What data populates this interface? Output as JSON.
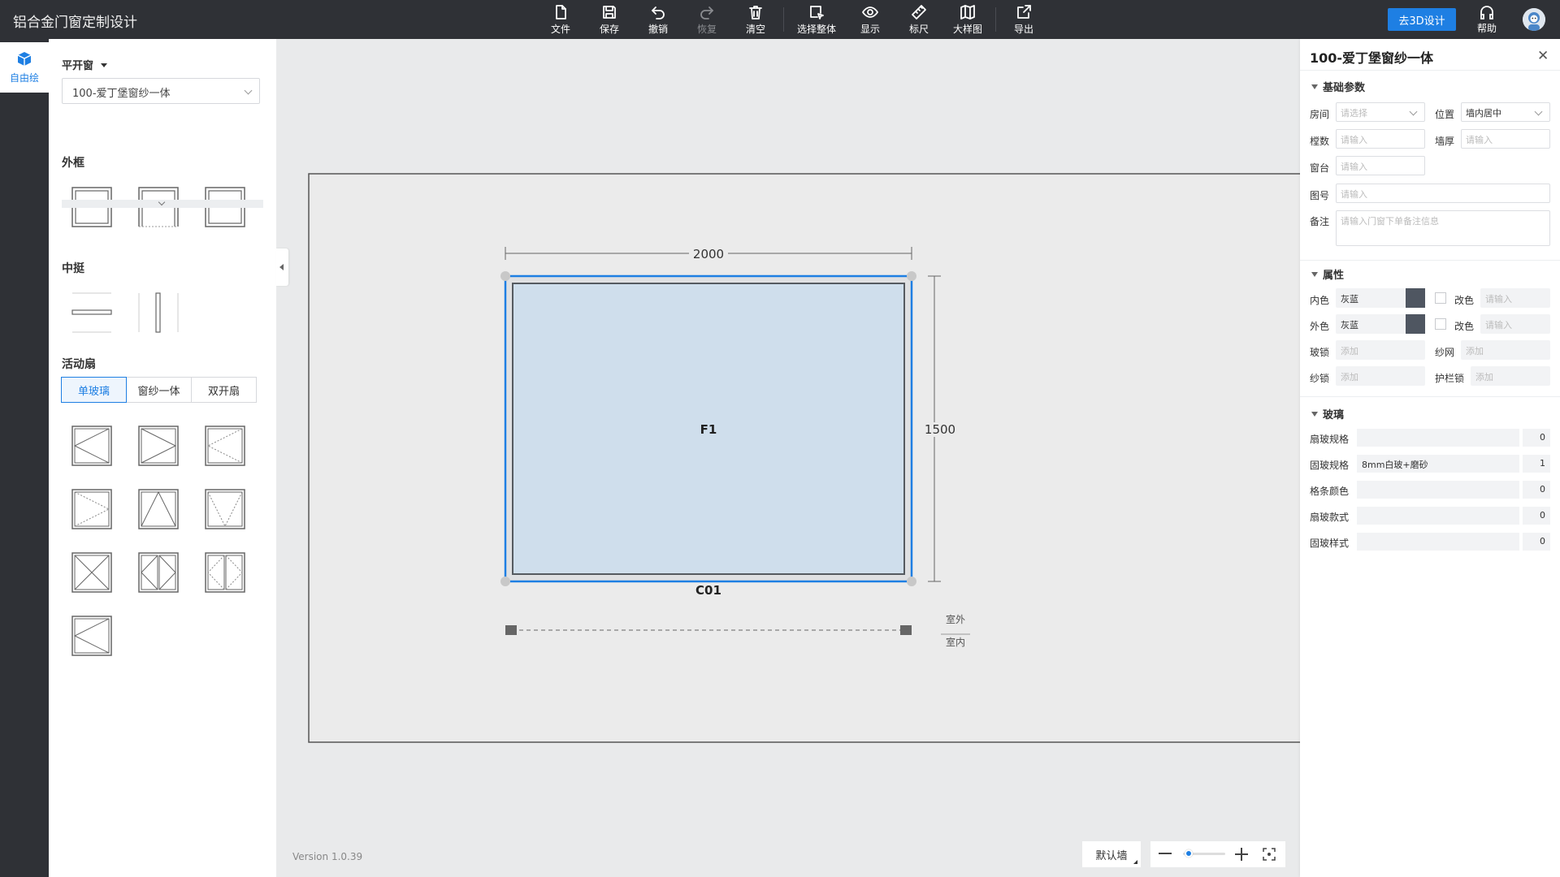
{
  "app": {
    "title": "铝合金门窗定制设计"
  },
  "toolbar": [
    {
      "label": "文件",
      "icon": "file-icon"
    },
    {
      "label": "保存",
      "icon": "save-icon"
    },
    {
      "label": "撤销",
      "icon": "undo-icon"
    },
    {
      "label": "恢复",
      "icon": "redo-icon",
      "disabled": true
    },
    {
      "label": "清空",
      "icon": "trash-icon"
    },
    {
      "label": "选择整体",
      "icon": "select-all-icon"
    },
    {
      "label": "显示",
      "icon": "eye-icon"
    },
    {
      "label": "标尺",
      "icon": "ruler-icon"
    },
    {
      "label": "大样图",
      "icon": "map-icon"
    },
    {
      "label": "导出",
      "icon": "export-icon"
    }
  ],
  "header": {
    "btn_3d": "去3D设计",
    "help": "帮助"
  },
  "rail": {
    "free_draw": "自由绘"
  },
  "left_panel": {
    "category": "平开窗",
    "series_select": "100-爱丁堡窗纱一体",
    "sections": {
      "outer_frame": "外框",
      "mullion": "中挺",
      "sash": "活动扇"
    },
    "sash_tabs": [
      "单玻璃",
      "窗纱一体",
      "双开扇"
    ],
    "active_sash_tab": 0
  },
  "canvas": {
    "width_dim": "2000",
    "height_dim": "1500",
    "panel_label": "F1",
    "window_code": "C01",
    "outside_label": "室外",
    "inside_label": "室内",
    "version": "Version 1.0.39",
    "default_wall": "默认墙"
  },
  "right_panel": {
    "title": "100-爱丁堡窗纱一体",
    "basic_section": "基础参数",
    "room_label": "房间",
    "room_placeholder": "请选择",
    "position_label": "位置",
    "position_value": "墙内居中",
    "floors_label": "樘数",
    "floors_placeholder": "请输入",
    "wall_label": "墙厚",
    "wall_placeholder": "请输入",
    "sill_label": "窗台",
    "sill_placeholder": "请输入",
    "drawing_label": "图号",
    "drawing_placeholder": "请输入",
    "remark_label": "备注",
    "remark_placeholder": "请输入门窗下单备注信息",
    "attr_section": "属性",
    "inner_color_label": "内色",
    "inner_color_value": "灰蓝",
    "outer_color_label": "外色",
    "outer_color_value": "灰蓝",
    "change_color_label": "改色",
    "change_color_placeholder": "请输入",
    "glass_lock_label": "玻锁",
    "screen_label": "纱网",
    "screen_lock_label": "纱锁",
    "guard_lock_label": "护栏锁",
    "add_placeholder": "添加",
    "swatch_color": "#4f5661",
    "glass_section": "玻璃",
    "glass_rows": [
      {
        "label": "扇玻规格",
        "value": "",
        "count": "0"
      },
      {
        "label": "固玻规格",
        "value": "8mm白玻+磨砂",
        "count": "1"
      },
      {
        "label": "格条颜色",
        "value": "",
        "count": "0"
      },
      {
        "label": "扇玻款式",
        "value": "",
        "count": "0"
      },
      {
        "label": "固玻样式",
        "value": "",
        "count": "0"
      }
    ]
  },
  "colors": {
    "accent": "#1e7fe3",
    "topbar": "#2f3136",
    "glass": "#cfdeec",
    "frame": "#555a60"
  }
}
